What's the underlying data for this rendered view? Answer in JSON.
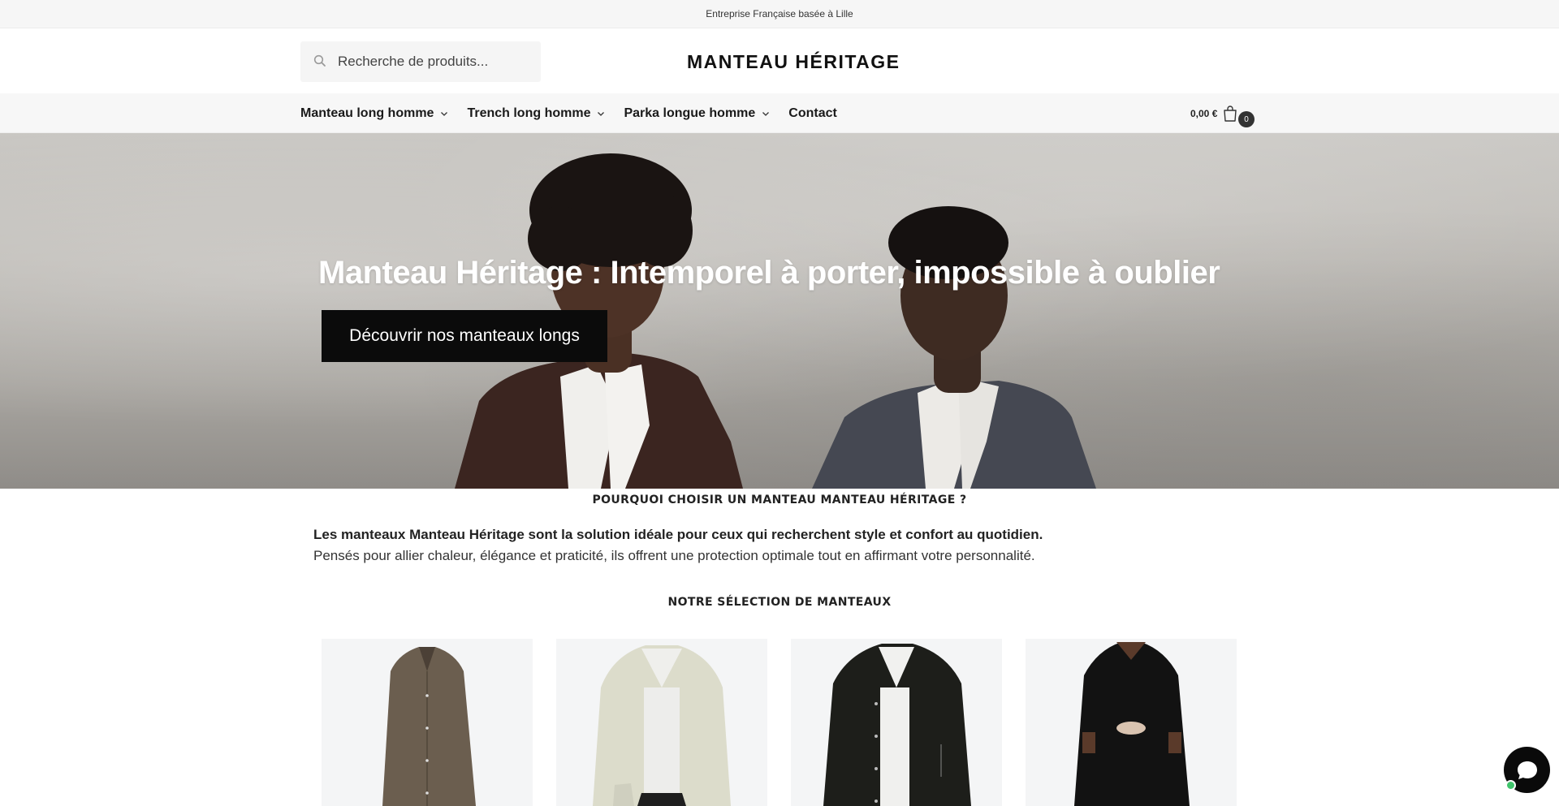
{
  "announcement": "Entreprise Française basée à Lille",
  "search": {
    "placeholder": "Recherche de produits..."
  },
  "brand": {
    "name": "MANTEAU HÉRITAGE"
  },
  "nav": {
    "items": [
      {
        "label": "Manteau long homme",
        "has_dropdown": true
      },
      {
        "label": "Trench long homme",
        "has_dropdown": true
      },
      {
        "label": "Parka longue homme",
        "has_dropdown": true
      },
      {
        "label": "Contact",
        "has_dropdown": false
      }
    ]
  },
  "cart": {
    "total": "0,00 €",
    "count": "0"
  },
  "hero": {
    "title": "Manteau Héritage : Intemporel à porter, impossible à oublier",
    "cta_label": "Découvrir nos manteaux longs"
  },
  "why": {
    "title": "POURQUOI CHOISIR UN MANTEAU MANTEAU HÉRITAGE ?",
    "line1": "Les manteaux Manteau Héritage sont la solution idéale pour ceux qui recherchent style et confort au quotidien.",
    "line2": "Pensés pour allier chaleur, élégance et praticité, ils offrent une protection optimale tout en affirmant votre personnalité."
  },
  "selection": {
    "title": "NOTRE SÉLECTION DE MANTEAUX",
    "products": [
      {
        "image": "brown-long-coat",
        "color": "#6b5e4f"
      },
      {
        "image": "cream-jacket",
        "color": "#dcdccb"
      },
      {
        "image": "black-jacket",
        "color": "#1d1e1a"
      },
      {
        "image": "black-long-coat",
        "color": "#121212"
      }
    ]
  },
  "colors": {
    "accent": "#0b0b0b",
    "chat_online": "#3fc46b"
  },
  "icons": {
    "search": "search-icon",
    "cart": "shopping-bag-icon",
    "chat": "chat-icon",
    "dropdown": "chevron-down-icon"
  }
}
